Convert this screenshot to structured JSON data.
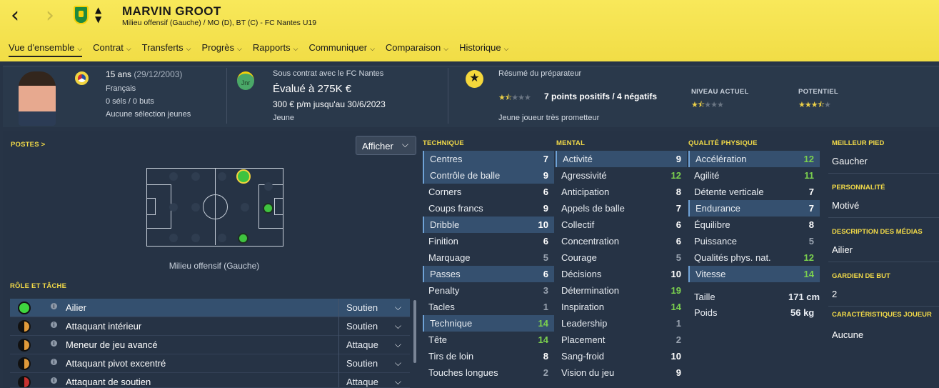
{
  "header": {
    "back_icon": "‹",
    "forward_icon": "›",
    "player_name": "MARVIN GROOT",
    "subtitle": "Milieu offensif (Gauche) / MO (D), BT (C) - FC Nantes U19"
  },
  "tabs": [
    {
      "label": "Vue d'ensemble",
      "active": true
    },
    {
      "label": "Contrat"
    },
    {
      "label": "Transferts"
    },
    {
      "label": "Progrès"
    },
    {
      "label": "Rapports"
    },
    {
      "label": "Communiquer"
    },
    {
      "label": "Comparaison"
    },
    {
      "label": "Historique"
    }
  ],
  "summary": {
    "age": "15 ans",
    "dob": "(29/12/2003)",
    "nationality": "Français",
    "caps": "0 séls / 0 buts",
    "youth": "Aucune sélection jeunes",
    "contract_line": "Sous contrat avec le FC Nantes",
    "value": "Évalué à 275K €",
    "wage": "300 € p/m jusqu'au 30/6/2023",
    "status": "Jeune",
    "badge_text": "Jnr",
    "coach_title": "Résumé du préparateur",
    "coach_points": "7 points positifs / 4 négatifs",
    "coach_summary": "Jeune joueur très prometteur",
    "current_label": "NIVEAU ACTUEL",
    "potential_label": "POTENTIEL",
    "coach_stars": 1.5,
    "current_stars": 1.5,
    "potential_stars": 3.5
  },
  "positions": {
    "label": "POSTES >",
    "caption": "Milieu offensif (Gauche)",
    "display_button": "Afficher"
  },
  "roles": {
    "label": "RÔLE ET TÂCHE",
    "rows": [
      {
        "name": "Ailier",
        "duty": "Soutien",
        "rating": "full"
      },
      {
        "name": "Attaquant intérieur",
        "duty": "Soutien",
        "rating": "half"
      },
      {
        "name": "Meneur de jeu avancé",
        "duty": "Attaque",
        "rating": "half"
      },
      {
        "name": "Attaquant pivot excentré",
        "duty": "Soutien",
        "rating": "half"
      },
      {
        "name": "Attaquant de soutien",
        "duty": "Attaque",
        "rating": "red"
      }
    ]
  },
  "technique": {
    "label": "TECHNIQUE",
    "rows": [
      {
        "name": "Centres",
        "value": "7",
        "hl": true
      },
      {
        "name": "Contrôle de balle",
        "value": "9",
        "hl": true
      },
      {
        "name": "Corners",
        "value": "6"
      },
      {
        "name": "Coups francs",
        "value": "9"
      },
      {
        "name": "Dribble",
        "value": "10",
        "hl": true
      },
      {
        "name": "Finition",
        "value": "6"
      },
      {
        "name": "Marquage",
        "value": "5"
      },
      {
        "name": "Passes",
        "value": "6",
        "hl": true
      },
      {
        "name": "Penalty",
        "value": "3"
      },
      {
        "name": "Tacles",
        "value": "1"
      },
      {
        "name": "Technique",
        "value": "14",
        "hl": true
      },
      {
        "name": "Tête",
        "value": "14"
      },
      {
        "name": "Tirs de loin",
        "value": "8"
      },
      {
        "name": "Touches longues",
        "value": "2"
      }
    ]
  },
  "mental": {
    "label": "MENTAL",
    "rows": [
      {
        "name": "Activité",
        "value": "9",
        "hl": true
      },
      {
        "name": "Agressivité",
        "value": "12"
      },
      {
        "name": "Anticipation",
        "value": "8"
      },
      {
        "name": "Appels de balle",
        "value": "7"
      },
      {
        "name": "Collectif",
        "value": "6"
      },
      {
        "name": "Concentration",
        "value": "6"
      },
      {
        "name": "Courage",
        "value": "5"
      },
      {
        "name": "Décisions",
        "value": "10"
      },
      {
        "name": "Détermination",
        "value": "19"
      },
      {
        "name": "Inspiration",
        "value": "14"
      },
      {
        "name": "Leadership",
        "value": "1"
      },
      {
        "name": "Placement",
        "value": "2"
      },
      {
        "name": "Sang-froid",
        "value": "10"
      },
      {
        "name": "Vision du jeu",
        "value": "9"
      }
    ]
  },
  "physical": {
    "label": "QUALITÉ PHYSIQUE",
    "rows": [
      {
        "name": "Accélération",
        "value": "12",
        "hl": true
      },
      {
        "name": "Agilité",
        "value": "11"
      },
      {
        "name": "Détente verticale",
        "value": "7"
      },
      {
        "name": "Endurance",
        "value": "7",
        "hl": true
      },
      {
        "name": "Équilibre",
        "value": "8"
      },
      {
        "name": "Puissance",
        "value": "5"
      },
      {
        "name": "Qualités phys. nat.",
        "value": "12"
      },
      {
        "name": "Vitesse",
        "value": "14",
        "hl": true
      }
    ],
    "height_label": "Taille",
    "height": "171 cm",
    "weight_label": "Poids",
    "weight": "56 kg"
  },
  "info": [
    {
      "label": "MEILLEUR PIED",
      "value": "Gaucher"
    },
    {
      "label": "PERSONNALITÉ",
      "value": "Motivé"
    },
    {
      "label": "DESCRIPTION DES MÉDIAS",
      "value": "Ailier"
    },
    {
      "label": "GARDIEN DE BUT",
      "value": "2"
    },
    {
      "label": "CARACTÉRISTIQUES JOUEUR",
      "value": "Aucune"
    }
  ],
  "colors": {
    "header": "#f1dd46",
    "highlight": "#35506f",
    "good": "#7bd04e"
  }
}
